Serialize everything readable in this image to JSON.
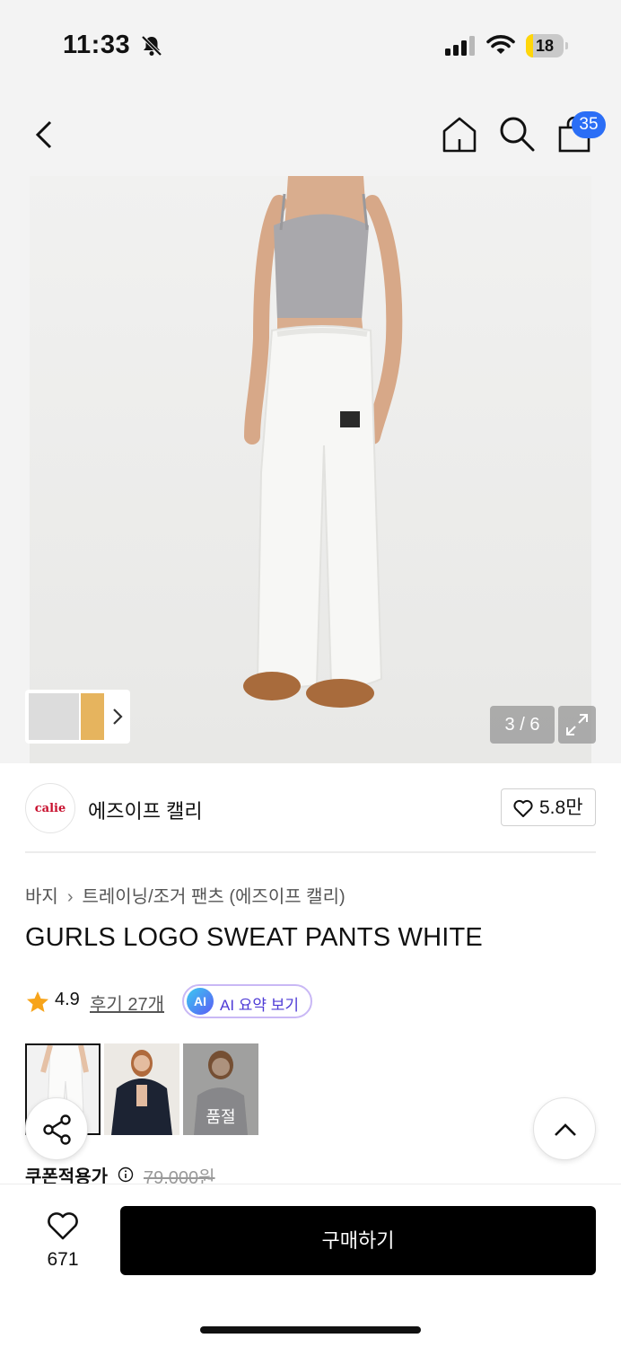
{
  "status_bar": {
    "time": "11:33",
    "battery_level": "18",
    "battery_fraction": 0.18,
    "battery_color": "#ffd60a"
  },
  "nav": {
    "cart_count": "35",
    "badge_color": "#2b6ef6"
  },
  "gallery": {
    "page_indicator": "3 / 6"
  },
  "brand": {
    "logo_text": "calie",
    "name": "에즈이프 캘리",
    "like_count": "5.8만"
  },
  "product": {
    "breadcrumb": [
      "바지",
      "트레이닝/조거 팬츠 (에즈이프 캘리)"
    ],
    "title": "GURLS LOGO SWEAT PANTS WHITE",
    "rating": "4.9",
    "review_link": "후기 27개",
    "ai_badge": "AI",
    "ai_summary_label": "AI 요약 보기",
    "options": [
      {
        "name": "white",
        "sold_out": false
      },
      {
        "name": "black",
        "sold_out": false
      },
      {
        "name": "grey",
        "sold_out": true,
        "status": "품절"
      }
    ],
    "coupon_label": "쿠폰적용가",
    "original_price": "79,000원"
  },
  "bottom_bar": {
    "wish_count": "671",
    "buy_label": "구매하기"
  },
  "icons": [
    "bell-slash-icon",
    "signal-icon",
    "wifi-icon",
    "battery-icon",
    "back-icon",
    "home-icon",
    "search-icon",
    "cart-icon",
    "chevron-right-icon",
    "expand-icon",
    "heart-icon",
    "star-icon",
    "share-icon",
    "chevron-up-icon",
    "info-icon"
  ]
}
